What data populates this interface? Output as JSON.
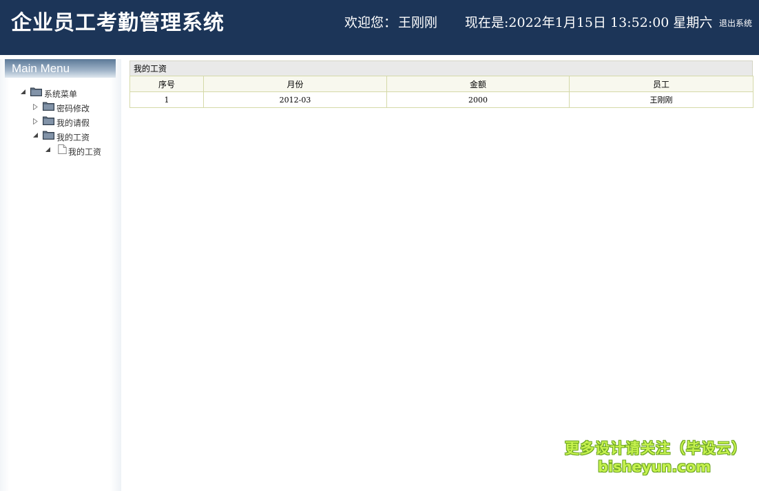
{
  "header": {
    "title": "企业员工考勤管理系统",
    "welcome_label": "欢迎您：",
    "user_name": "王刚刚",
    "clock": "现在是:2022年1月15日 13:52:00 星期六",
    "logout": "退出系统"
  },
  "sidebar": {
    "heading": "Main Menu",
    "tree": {
      "root": "系统菜单",
      "items": [
        {
          "label": "密码修改",
          "expanded": false
        },
        {
          "label": "我的请假",
          "expanded": false
        },
        {
          "label": "我的工资",
          "expanded": true,
          "children": [
            "我的工资"
          ]
        }
      ]
    }
  },
  "main": {
    "panel_title": "我的工资",
    "columns": [
      "序号",
      "月份",
      "金额",
      "员工"
    ],
    "rows": [
      [
        "1",
        "2012-03",
        "2000",
        "王刚刚"
      ]
    ]
  },
  "watermark": {
    "line1": "更多设计请关注（毕设云）",
    "line2": "bisheyun.com"
  },
  "colors": {
    "header_bg": "#1c3558",
    "grid_border": "#d4d9a8",
    "watermark": "#c6f24e"
  }
}
